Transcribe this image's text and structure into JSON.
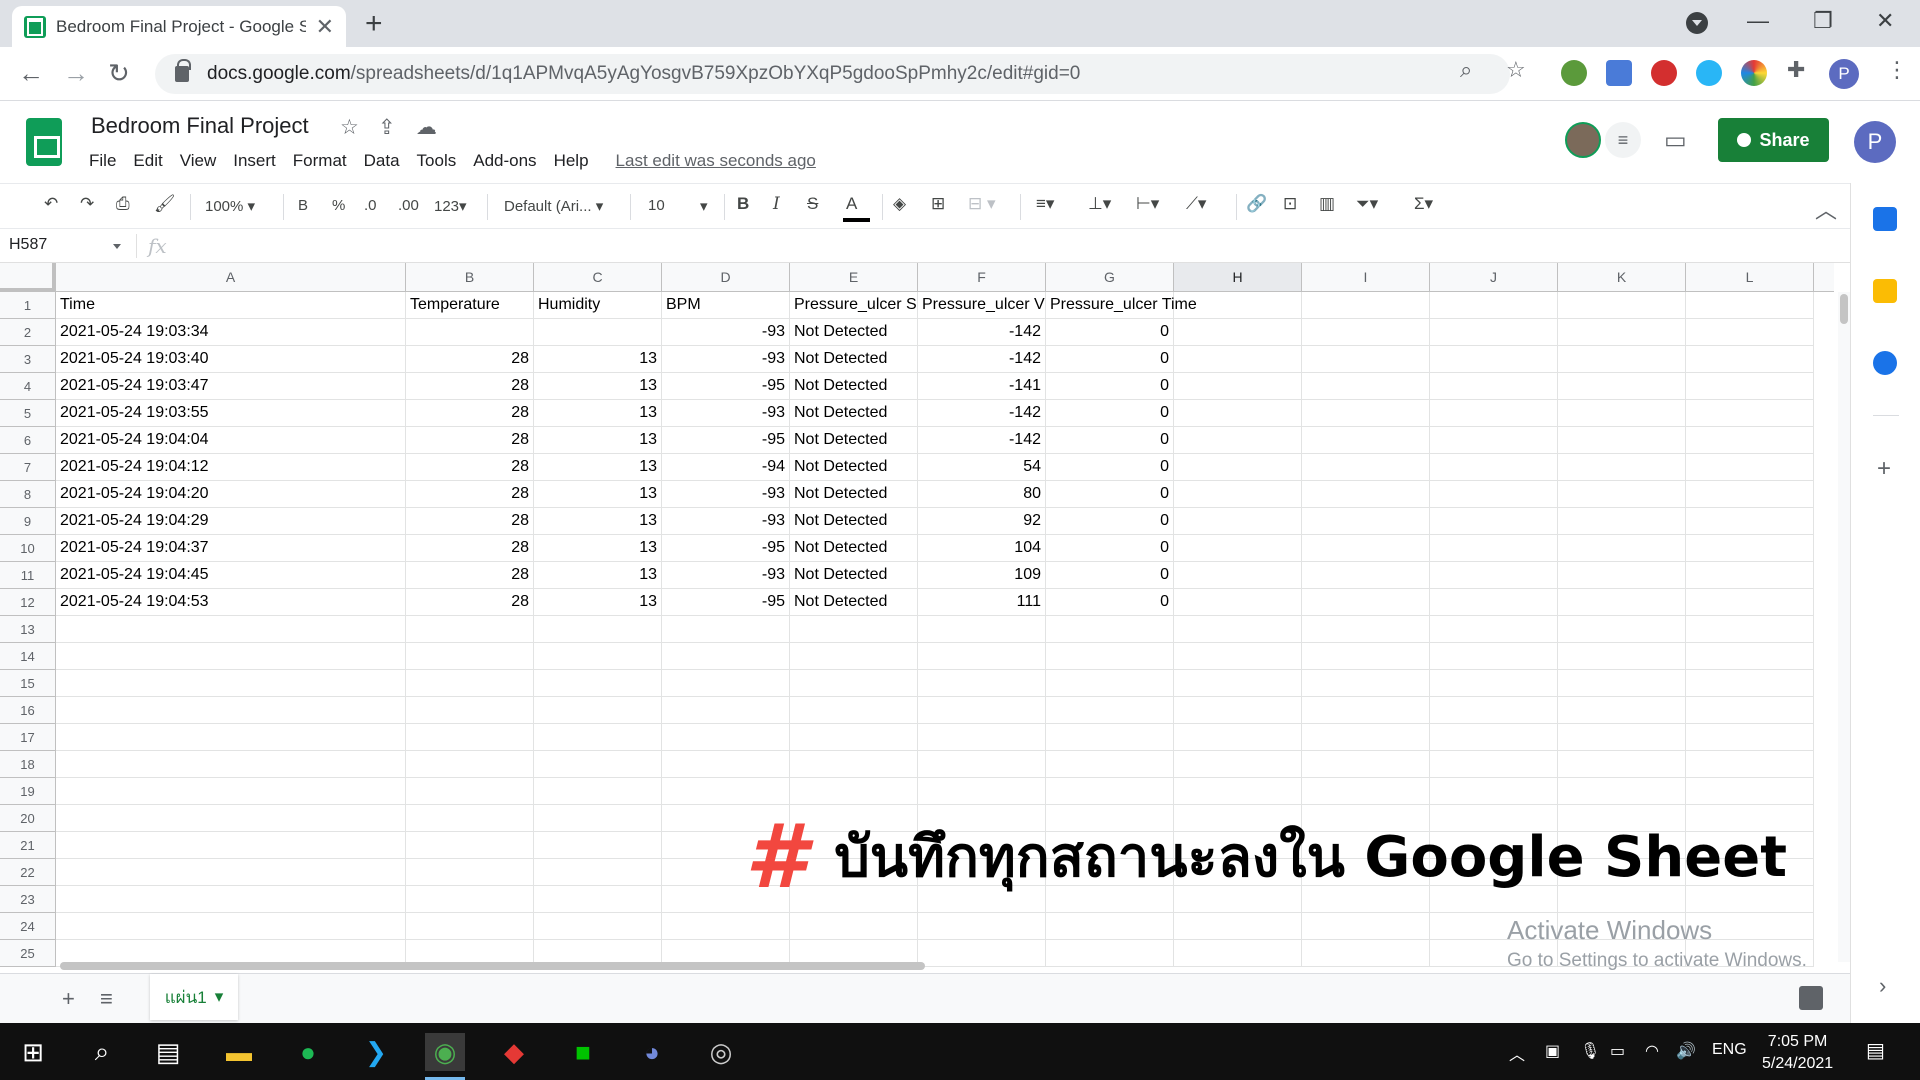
{
  "browser": {
    "tab_title": "Bedroom Final Project - Google Sheets",
    "url_host": "docs.google.com",
    "url_path": "/spreadsheets/d/1q1APMvqA5yAgYosgvB759XpzObYXqP5gdooSpPmhy2c/edit#gid=0",
    "profile_initial": "P"
  },
  "sheets": {
    "title": "Bedroom Final Project",
    "menu": [
      "File",
      "Edit",
      "View",
      "Insert",
      "Format",
      "Data",
      "Tools",
      "Add-ons",
      "Help"
    ],
    "last_edit": "Last edit was seconds ago",
    "share_label": "Share",
    "account_initial": "P"
  },
  "toolbar": {
    "zoom": "100%",
    "bold": "B",
    "percent": "%",
    "dec_decrease": ".0",
    "dec_increase": ".00",
    "number_format": "123",
    "font": "Default (Ari...",
    "font_size": "10"
  },
  "formula_bar": {
    "cell_ref": "H587",
    "fx": "fx",
    "value": ""
  },
  "grid": {
    "columns": [
      "A",
      "B",
      "C",
      "D",
      "E",
      "F",
      "G",
      "H",
      "I",
      "J",
      "K",
      "L"
    ],
    "selected_column": "H",
    "headers": [
      "Time",
      "Temperature",
      "Humidity",
      "BPM",
      "Pressure_ulcer S",
      "Pressure_ulcer V",
      "Pressure_ulcer Time",
      "",
      "",
      "",
      "",
      ""
    ],
    "rows": [
      [
        "2021-05-24 19:03:34",
        "",
        "",
        "-93",
        "Not Detected",
        "-142",
        "0"
      ],
      [
        "2021-05-24 19:03:40",
        "28",
        "13",
        "-93",
        "Not Detected",
        "-142",
        "0"
      ],
      [
        "2021-05-24 19:03:47",
        "28",
        "13",
        "-95",
        "Not Detected",
        "-141",
        "0"
      ],
      [
        "2021-05-24 19:03:55",
        "28",
        "13",
        "-93",
        "Not Detected",
        "-142",
        "0"
      ],
      [
        "2021-05-24 19:04:04",
        "28",
        "13",
        "-95",
        "Not Detected",
        "-142",
        "0"
      ],
      [
        "2021-05-24 19:04:12",
        "28",
        "13",
        "-94",
        "Not Detected",
        "54",
        "0"
      ],
      [
        "2021-05-24 19:04:20",
        "28",
        "13",
        "-93",
        "Not Detected",
        "80",
        "0"
      ],
      [
        "2021-05-24 19:04:29",
        "28",
        "13",
        "-93",
        "Not Detected",
        "92",
        "0"
      ],
      [
        "2021-05-24 19:04:37",
        "28",
        "13",
        "-95",
        "Not Detected",
        "104",
        "0"
      ],
      [
        "2021-05-24 19:04:45",
        "28",
        "13",
        "-93",
        "Not Detected",
        "109",
        "0"
      ],
      [
        "2021-05-24 19:04:53",
        "28",
        "13",
        "-95",
        "Not Detected",
        "111",
        "0"
      ]
    ],
    "row_count": 25
  },
  "sheet_tabs": {
    "active": "แผ่น1"
  },
  "overlay": {
    "hash": "#",
    "caption": "บันทึกทุกสถานะลงใน Google Sheet",
    "activate_line1": "Activate Windows",
    "activate_line2": "Go to Settings to activate Windows."
  },
  "taskbar": {
    "language": "ENG",
    "time": "7:05 PM",
    "date": "5/24/2021"
  },
  "colors": {
    "sheets_green": "#0f9d58",
    "share_green": "#188038",
    "caption_red": "#f2473f"
  }
}
